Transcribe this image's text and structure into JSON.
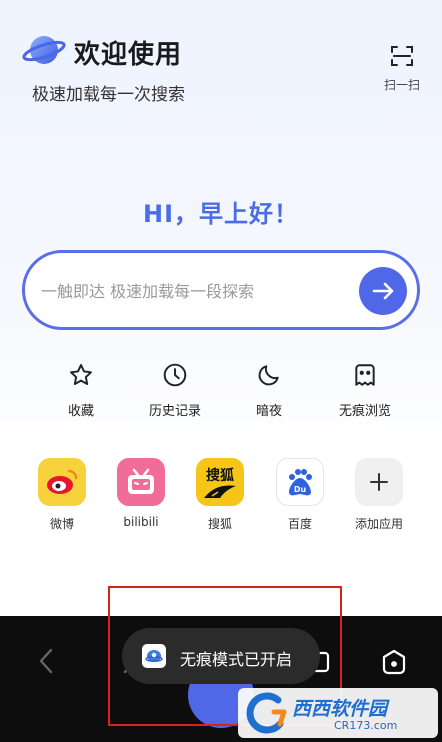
{
  "header": {
    "title": "欢迎使用",
    "tagline": "极速加载每一次搜索",
    "scan_label": "扫一扫"
  },
  "greeting": "HI，早上好！",
  "search": {
    "placeholder": "一触即达 极速加载每一段探索"
  },
  "quick_actions": [
    {
      "label": "收藏",
      "icon": "star-icon"
    },
    {
      "label": "历史记录",
      "icon": "clock-icon"
    },
    {
      "label": "暗夜",
      "icon": "moon-icon"
    },
    {
      "label": "无痕浏览",
      "icon": "ghost-icon"
    }
  ],
  "apps": [
    {
      "label": "微博",
      "icon": "weibo-icon",
      "color": "#f7d23c"
    },
    {
      "label": "bilibili",
      "icon": "bilibili-icon",
      "color": "#f06d98"
    },
    {
      "label": "搜狐",
      "icon": "sohu-icon",
      "color": "#f5c518"
    },
    {
      "label": "百度",
      "icon": "baidu-icon",
      "color": "#ffffff"
    },
    {
      "label": "添加应用",
      "icon": "plus-icon",
      "color": "#f0f0f0"
    }
  ],
  "toast": {
    "text": "无痕模式已开启"
  },
  "watermark": {
    "brand": "西西软件园",
    "url": "CR173.com"
  },
  "colors": {
    "accent": "#5068e8",
    "greeting": "#4a6ce6",
    "bottom_bar": "#0d0d0d",
    "highlight_box": "#d8231d"
  }
}
